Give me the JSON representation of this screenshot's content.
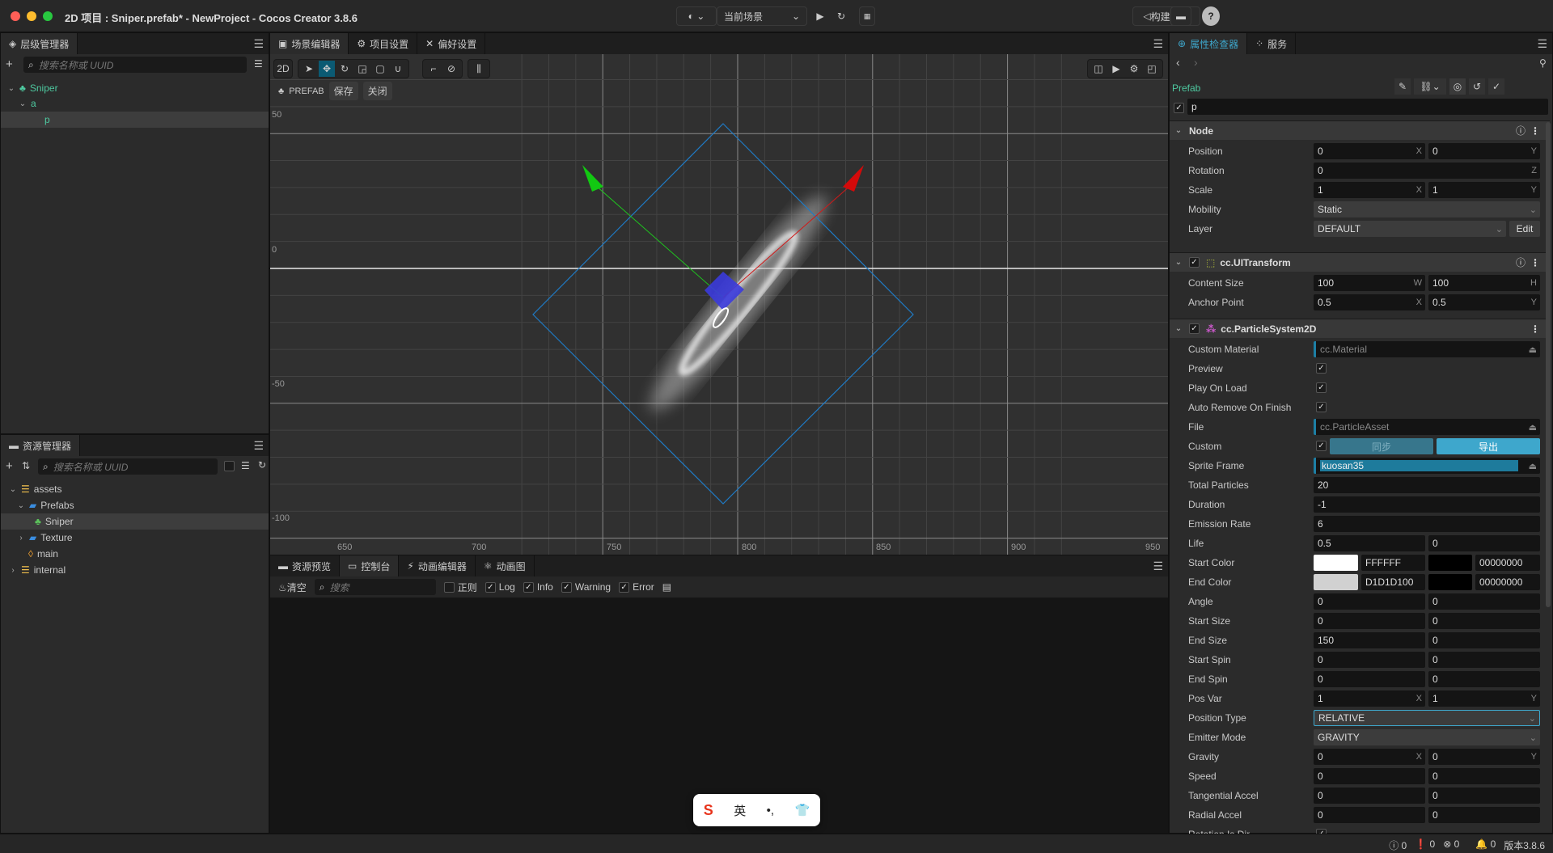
{
  "titlebar": {
    "title": "2D 项目 : Sniper.prefab* - NewProject - Cocos Creator 3.8.6",
    "scene_select": "当前场景",
    "build_button": "构建发布"
  },
  "hierarchy": {
    "tab": "层级管理器",
    "search_placeholder": "搜索名称或 UUID",
    "items": [
      {
        "label": "Sniper"
      },
      {
        "label": "a"
      },
      {
        "label": "p"
      }
    ]
  },
  "assets": {
    "tab": "资源管理器",
    "search_placeholder": "搜索名称或 UUID",
    "items": [
      {
        "label": "assets"
      },
      {
        "label": "Prefabs"
      },
      {
        "label": "Sniper"
      },
      {
        "label": "Texture"
      },
      {
        "label": "main"
      },
      {
        "label": "internal"
      }
    ]
  },
  "scene": {
    "tabs": [
      "场景编辑器",
      "项目设置",
      "偏好设置"
    ],
    "mode_2d": "2D",
    "prefab_label": "PREFAB",
    "save_button": "保存",
    "close_button": "关闭",
    "ruler_x": [
      "650",
      "700",
      "750",
      "800",
      "850",
      "900",
      "950"
    ],
    "ruler_y": [
      "50",
      "0",
      "-50",
      "-100"
    ]
  },
  "console": {
    "tabs": [
      "资源预览",
      "控制台",
      "动画编辑器",
      "动画图"
    ],
    "clear": "清空",
    "search_placeholder": "搜索",
    "regex": "正则",
    "filters": [
      "Log",
      "Info",
      "Warning",
      "Error"
    ]
  },
  "inspector": {
    "tabs": [
      "属性检查器",
      "服务"
    ],
    "prefab_label": "Prefab",
    "node_name": "p",
    "sections": [
      {
        "title": "Node",
        "rows": [
          {
            "label": "Position",
            "type": "vec2",
            "v": [
              "0",
              "0"
            ],
            "ax": [
              "X",
              "Y"
            ]
          },
          {
            "label": "Rotation",
            "type": "vec1",
            "v": [
              "0"
            ],
            "ax": [
              "Z"
            ]
          },
          {
            "label": "Scale",
            "type": "vec2",
            "v": [
              "1",
              "1"
            ],
            "ax": [
              "X",
              "Y"
            ]
          },
          {
            "label": "Mobility",
            "type": "select",
            "v": [
              "Static"
            ]
          },
          {
            "label": "Layer",
            "type": "layer",
            "v": [
              "DEFAULT",
              "Edit"
            ]
          }
        ]
      },
      {
        "title": "cc.UITransform",
        "rows": [
          {
            "label": "Content Size",
            "type": "vec2",
            "v": [
              "100",
              "100"
            ],
            "ax": [
              "W",
              "H"
            ]
          },
          {
            "label": "Anchor Point",
            "type": "vec2",
            "v": [
              "0.5",
              "0.5"
            ],
            "ax": [
              "X",
              "Y"
            ]
          }
        ]
      },
      {
        "title": "cc.ParticleSystem2D",
        "rows": [
          {
            "label": "Custom Material",
            "type": "asset",
            "v": [
              "cc.Material"
            ]
          },
          {
            "label": "Preview",
            "type": "check"
          },
          {
            "label": "Play On Load",
            "type": "check"
          },
          {
            "label": "Auto Remove On Finish",
            "type": "check"
          },
          {
            "label": "File",
            "type": "asset",
            "v": [
              "cc.ParticleAsset"
            ]
          },
          {
            "label": "Custom",
            "type": "custom",
            "v": [
              "同步",
              "导出"
            ]
          },
          {
            "label": "Sprite Frame",
            "type": "assetsel",
            "v": [
              "kuosan35"
            ]
          },
          {
            "label": "Total Particles",
            "type": "num",
            "v": [
              "20"
            ]
          },
          {
            "label": "Duration",
            "type": "num",
            "v": [
              "-1"
            ]
          },
          {
            "label": "Emission Rate",
            "type": "num",
            "v": [
              "6"
            ]
          },
          {
            "label": "Life",
            "type": "pair",
            "v": [
              "0.5",
              "0"
            ]
          },
          {
            "label": "Start Color",
            "type": "color",
            "v": [
              "FFFFFF",
              "00000000"
            ],
            "c": [
              "#ffffff",
              "#000000"
            ]
          },
          {
            "label": "End Color",
            "type": "color",
            "v": [
              "D1D1D100",
              "00000000"
            ],
            "c": [
              "#d1d1d1",
              "#000000"
            ]
          },
          {
            "label": "Angle",
            "type": "pair",
            "v": [
              "0",
              "0"
            ]
          },
          {
            "label": "Start Size",
            "type": "pair",
            "v": [
              "0",
              "0"
            ]
          },
          {
            "label": "End Size",
            "type": "pair",
            "v": [
              "150",
              "0"
            ]
          },
          {
            "label": "Start Spin",
            "type": "pair",
            "v": [
              "0",
              "0"
            ]
          },
          {
            "label": "End Spin",
            "type": "pair",
            "v": [
              "0",
              "0"
            ]
          },
          {
            "label": "Pos Var",
            "type": "vec2",
            "v": [
              "1",
              "1"
            ],
            "ax": [
              "X",
              "Y"
            ]
          },
          {
            "label": "Position Type",
            "type": "selectfocus",
            "v": [
              "RELATIVE"
            ]
          },
          {
            "label": "Emitter Mode",
            "type": "select",
            "v": [
              "GRAVITY"
            ]
          },
          {
            "label": "Gravity",
            "type": "vec2",
            "v": [
              "0",
              "0"
            ],
            "ax": [
              "X",
              "Y"
            ]
          },
          {
            "label": "Speed",
            "type": "pair",
            "v": [
              "0",
              "0"
            ]
          },
          {
            "label": "Tangential Accel",
            "type": "pair",
            "v": [
              "0",
              "0"
            ]
          },
          {
            "label": "Radial Accel",
            "type": "pair",
            "v": [
              "0",
              "0"
            ]
          },
          {
            "label": "Rotation Is Dir",
            "type": "check"
          }
        ]
      }
    ]
  },
  "status": {
    "info": "0",
    "warn": "0",
    "error": "0",
    "notify": "0",
    "version": "版本3.8.6"
  },
  "ime": {
    "lang": "英"
  },
  "colors": {
    "accent": "#3ea7cc",
    "node_green": "#4ec9a0"
  }
}
